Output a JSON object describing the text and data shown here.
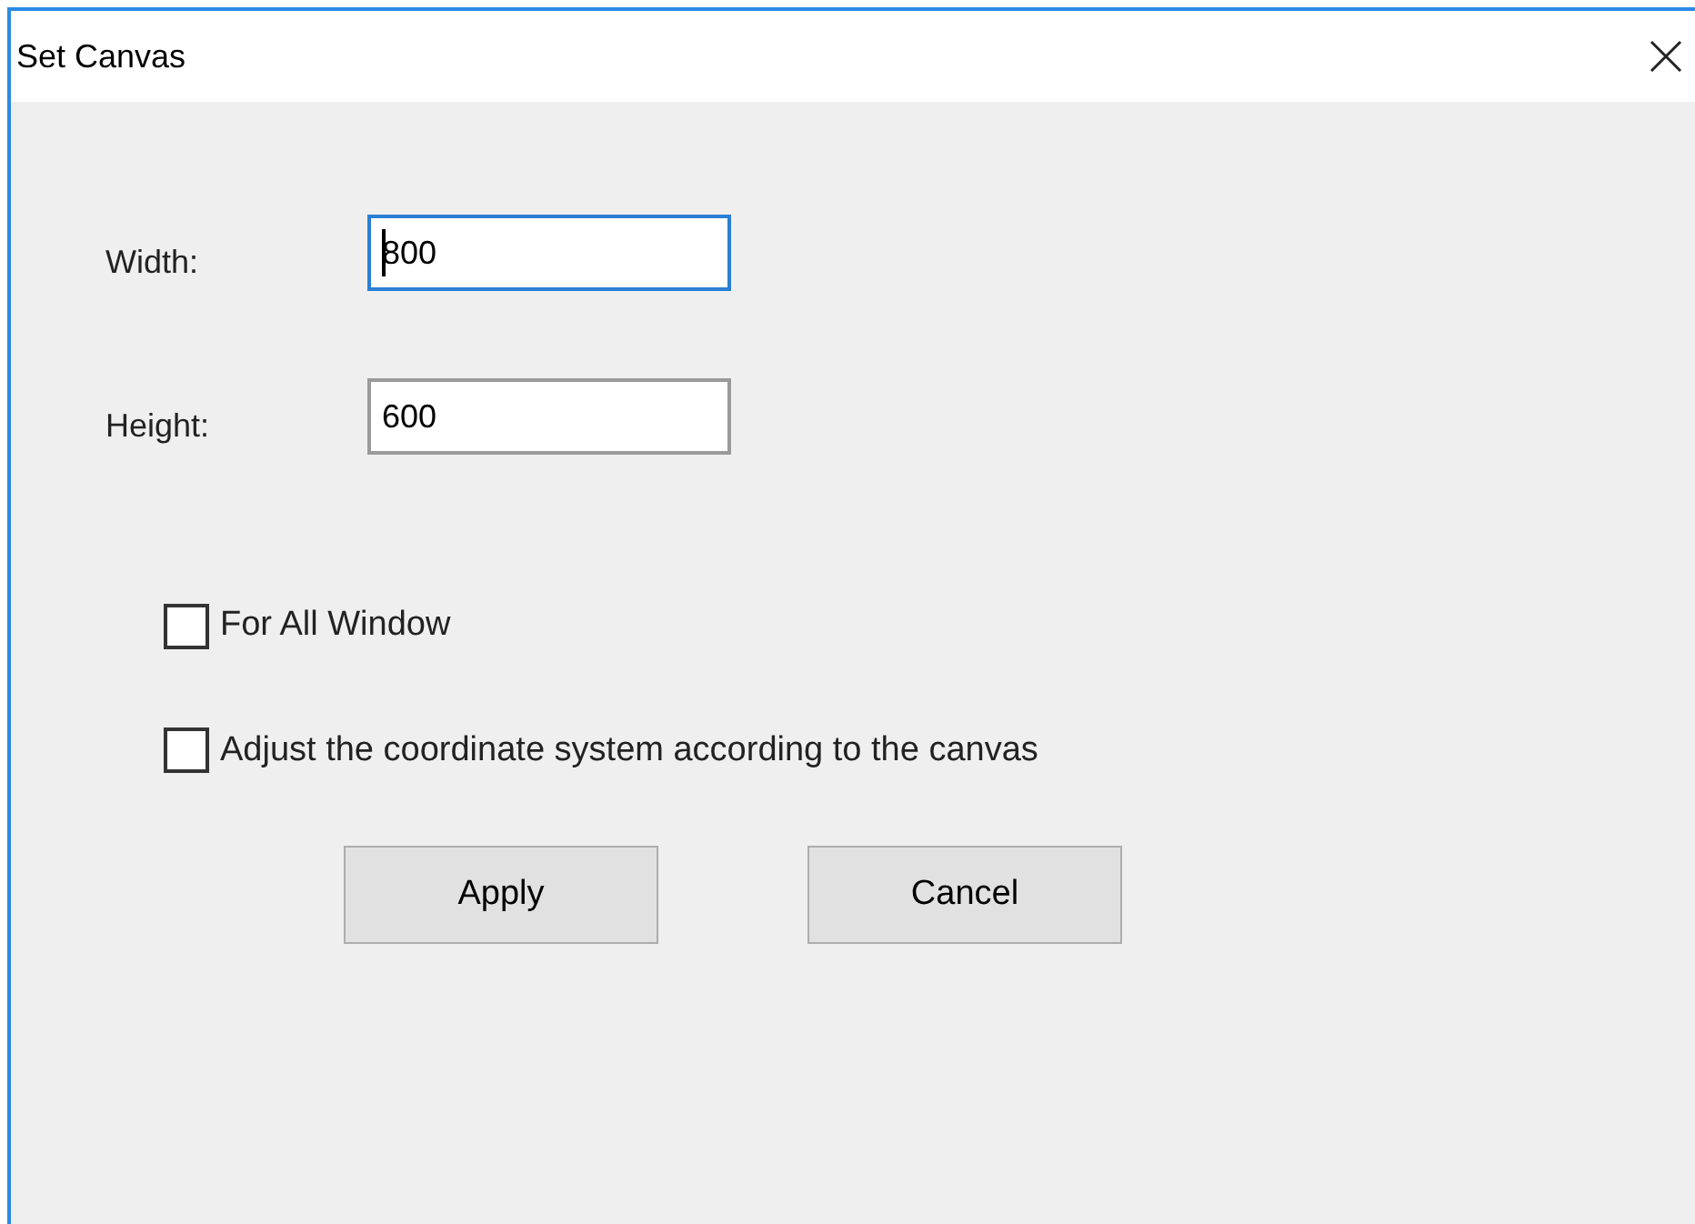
{
  "window": {
    "title": "Set Canvas"
  },
  "fields": [
    {
      "label": "Width:",
      "value": "800",
      "focused": true
    },
    {
      "label": "Height:",
      "value": "600",
      "focused": false
    }
  ],
  "checkboxes": [
    {
      "label": "For All Window",
      "checked": false
    },
    {
      "label": "Adjust the coordinate system according to the canvas",
      "checked": false
    }
  ],
  "buttons": [
    "Apply",
    "Cancel"
  ]
}
